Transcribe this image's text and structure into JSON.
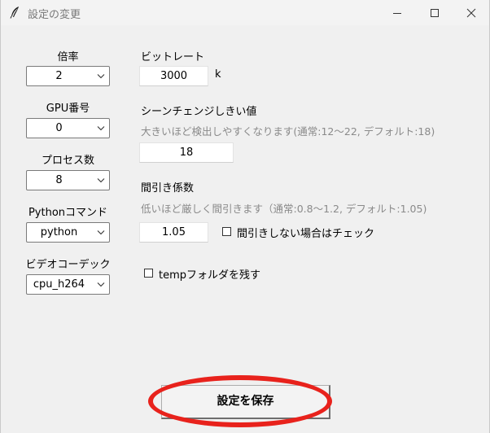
{
  "window": {
    "title": "設定の変更",
    "minimize_label": "minimize",
    "maximize_label": "maximize",
    "close_label": "close"
  },
  "left": {
    "scale_label": "倍率",
    "scale_value": "2",
    "gpu_label": "GPU番号",
    "gpu_value": "0",
    "process_label": "プロセス数",
    "process_value": "8",
    "python_label": "Pythonコマンド",
    "python_value": "python",
    "codec_label": "ビデオコーデック",
    "codec_value": "cpu_h264"
  },
  "right": {
    "bitrate_label": "ビットレート",
    "bitrate_value": "3000",
    "bitrate_unit": "k",
    "scene_label": "シーンチェンジしきい値",
    "scene_hint": "大きいほど検出しやすくなります(通常:12～22, デフォルト:18)",
    "scene_value": "18",
    "thin_label": "間引き係数",
    "thin_hint": "低いほど厳しく間引きます（通常:0.8～1.2, デフォルト:1.05)",
    "thin_value": "1.05",
    "no_thin_check_label": "間引きしない場合はチェック",
    "no_thin_checked": false,
    "keep_temp_label": "tempフォルダを残す",
    "keep_temp_checked": false
  },
  "footer": {
    "save_label": "設定を保存"
  },
  "colors": {
    "highlight": "#e8221c",
    "window_bg": "#f0f0f0",
    "hint_text": "#8a8a8a"
  },
  "icons": {
    "app": "feather-icon",
    "combo_arrow": "chevron-down-icon"
  }
}
